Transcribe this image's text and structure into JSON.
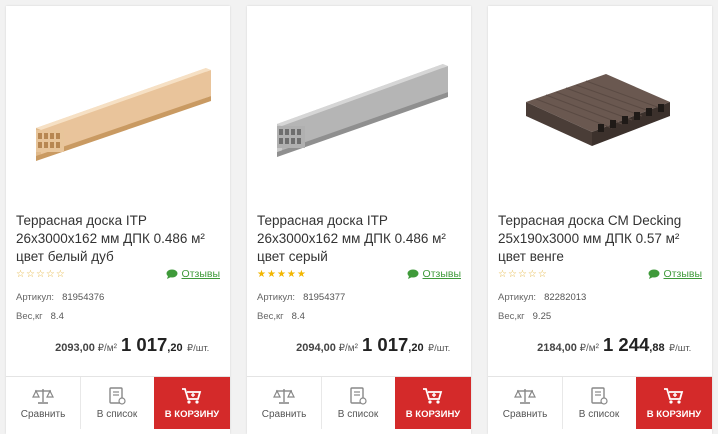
{
  "products": [
    {
      "title": "Террасная доска ITP 26х3000х162 мм ДПК 0.486 м² цвет белый дуб",
      "rating_filled": 0,
      "reviews_label": "Отзывы",
      "article_label": "Артикул:",
      "article": "81954376",
      "weight_label": "Вес,кг",
      "weight": "8.4",
      "unit_price": "2093,00",
      "unit_price_suffix": "₽/м²",
      "price_int": "1 017",
      "price_dec": ",20",
      "price_suffix": "₽/шт.",
      "compare_label": "Сравнить",
      "list_label": "В список",
      "cart_label": "В КОРЗИНУ",
      "board_color": "#e8c69a"
    },
    {
      "title": "Террасная доска ITP 26х3000х162 мм ДПК 0.486 м² цвет серый",
      "rating_filled": 5,
      "reviews_label": "Отзывы",
      "article_label": "Артикул:",
      "article": "81954377",
      "weight_label": "Вес,кг",
      "weight": "8.4",
      "unit_price": "2094,00",
      "unit_price_suffix": "₽/м²",
      "price_int": "1 017",
      "price_dec": ",20",
      "price_suffix": "₽/шт.",
      "compare_label": "Сравнить",
      "list_label": "В список",
      "cart_label": "В КОРЗИНУ",
      "board_color": "#a9a9a9"
    },
    {
      "title": "Террасная доска СМ Decking 25х190х3000 мм ДПК 0.57 м² цвет венге",
      "rating_filled": 0,
      "reviews_label": "Отзывы",
      "article_label": "Артикул:",
      "article": "82282013",
      "weight_label": "Вес,кг",
      "weight": "9.25",
      "unit_price": "2184,00",
      "unit_price_suffix": "₽/м²",
      "price_int": "1 244",
      "price_dec": ",88",
      "price_suffix": "₽/шт.",
      "compare_label": "Сравнить",
      "list_label": "В список",
      "cart_label": "В КОРЗИНУ",
      "board_color": "#5a4a42"
    }
  ],
  "colors": {
    "cart_button": "#d42a2a",
    "reviews_link": "#3f9a3a",
    "star": "#f2b600"
  }
}
